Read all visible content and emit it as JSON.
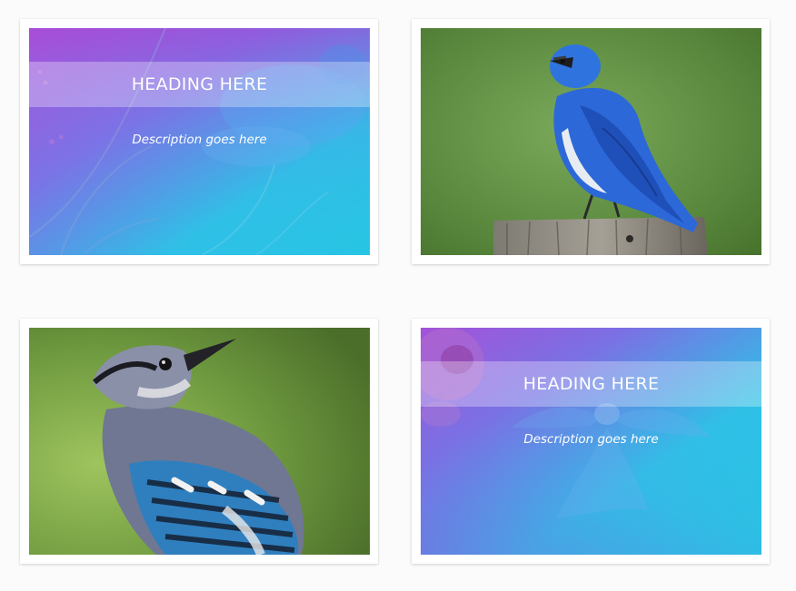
{
  "cards": [
    {
      "kind": "overlay",
      "image": "bluebird-overlay-photo",
      "heading": "HEADING HERE",
      "description": "Description goes here"
    },
    {
      "kind": "photo",
      "image": "mountain-bluebird-on-post-photo"
    },
    {
      "kind": "photo",
      "image": "blue-jay-photo"
    },
    {
      "kind": "overlay",
      "image": "flying-bird-overlay-photo",
      "heading": "HEADING HERE",
      "description": "Description goes here"
    }
  ],
  "colors": {
    "overlay_top": "#9b46d8",
    "overlay_bottom": "#23c3e6",
    "photo_green": "#5d8a3e",
    "bird_blue": "#2f6fd6"
  }
}
